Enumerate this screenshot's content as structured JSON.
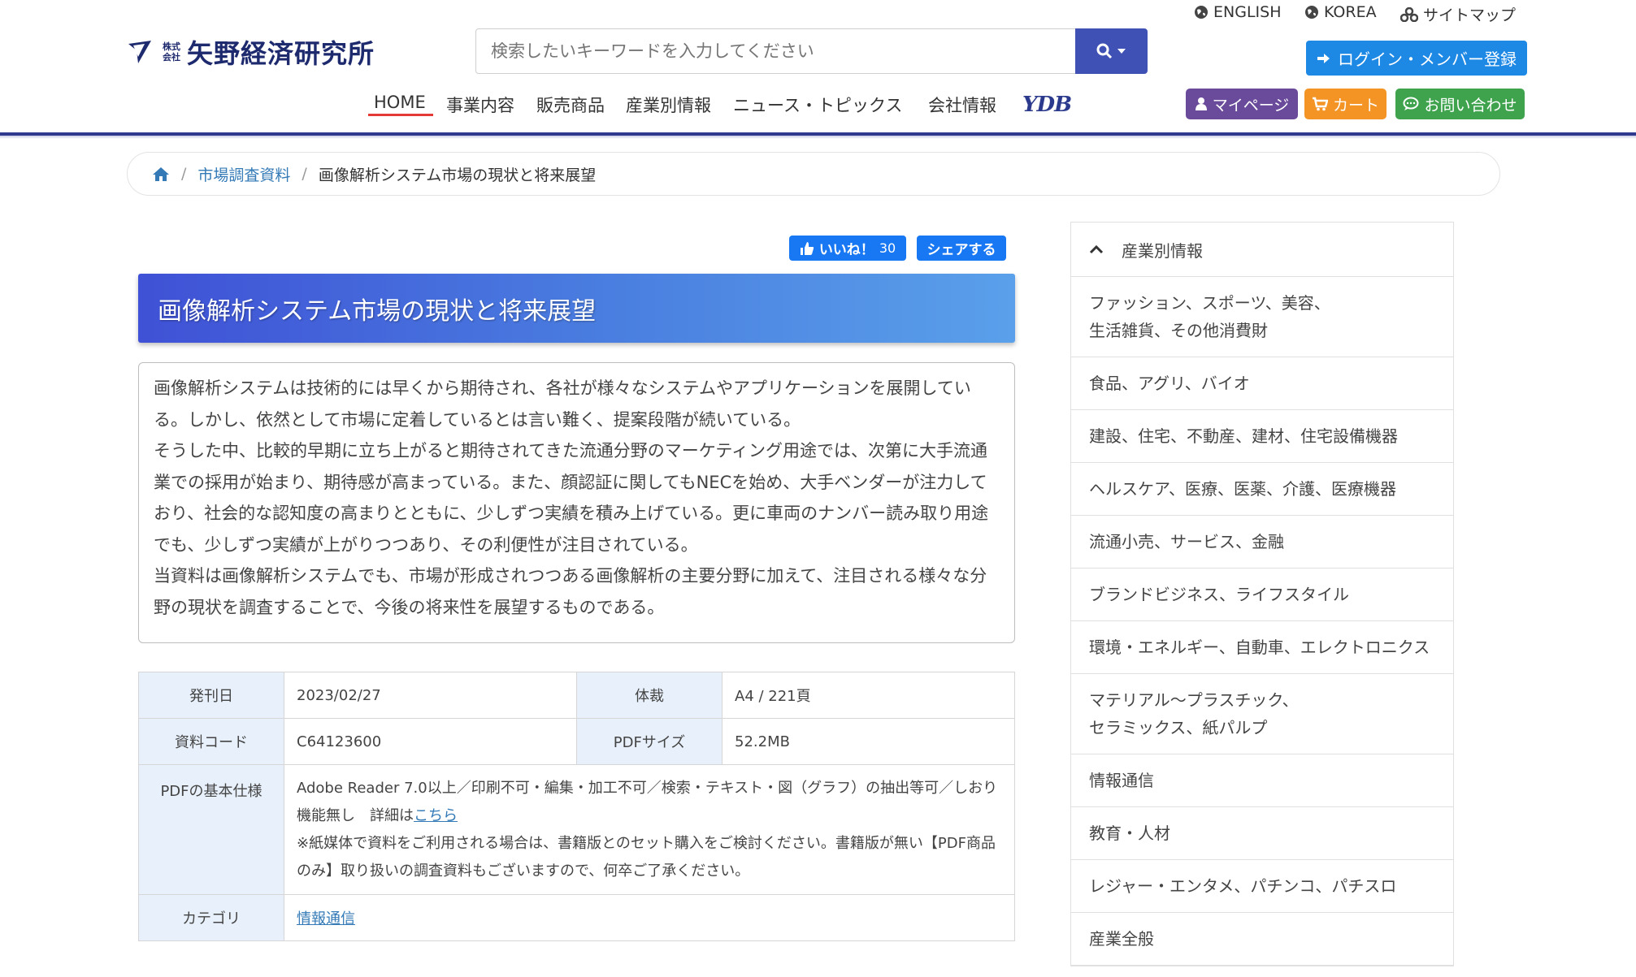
{
  "company": {
    "kabushiki": "株式",
    "kaisha": "会社",
    "name": "矢野経済研究所"
  },
  "search": {
    "placeholder": "検索したいキーワードを入力してください"
  },
  "top_links": {
    "english": "ENGLISH",
    "korea": "KOREA",
    "sitemap": "サイトマップ"
  },
  "login_label": "ログイン・メンバー登録",
  "nav": {
    "items": [
      "HOME",
      "事業内容",
      "販売商品",
      "産業別情報",
      "ニュース・トピックス",
      "会社情報"
    ],
    "ydb": "YDB"
  },
  "pills": {
    "mypage": "マイページ",
    "cart": "カート",
    "contact": "お問い合わせ"
  },
  "colors": {
    "accent": "#3f51b5",
    "mypage": "#6a4a9a",
    "cart": "#f39425",
    "contact": "#3fa34d",
    "login": "#1e88e5",
    "facebook": "#1877f2"
  },
  "breadcrumb": {
    "icon": "home-icon",
    "level1": "市場調査資料",
    "current": "画像解析システム市場の現状と将来展望"
  },
  "social": {
    "like_label": "いいね！",
    "like_count": "30",
    "share_label": "シェアする"
  },
  "title": "画像解析システム市場の現状と将来展望",
  "description": {
    "p1": "画像解析システムは技術的には早くから期待され、各社が様々なシステムやアプリケーションを展開している。しかし、依然として市場に定着しているとは言い難く、提案段階が続いている。",
    "p2": "そうした中、比較的早期に立ち上がると期待されてきた流通分野のマーケティング用途では、次第に大手流通業での採用が始まり、期待感が高まっている。また、顔認証に関してもNECを始め、大手ベンダーが注力しており、社会的な認知度の高まりとともに、少しずつ実績を積み上げている。更に車両のナンバー読み取り用途でも、少しずつ実績が上がりつつあり、その利便性が注目されている。",
    "p3": "当資料は画像解析システムでも、市場が形成されつつある画像解析の主要分野に加えて、注目される様々な分野の現状を調査することで、今後の将来性を展望するものである。"
  },
  "spec": {
    "issue_label": "発刊日",
    "issue_value": "2023/02/27",
    "format_label": "体裁",
    "format_value": "A4 / 221頁",
    "code_label": "資料コード",
    "code_value": "C64123600",
    "pdfsize_label": "PDFサイズ",
    "pdfsize_value": "52.2MB",
    "pdfspec_label": "PDFの基本仕様",
    "pdfspec_value": "Adobe Reader 7.0以上／印刷不可・編集・加工不可／検索・テキスト・図（グラフ）の抽出等可／しおり機能無し　詳細は",
    "pdfspec_link": "こちら",
    "pdfspec_note": "※紙媒体で資料をご利用される場合は、書籍版とのセット購入をご検討ください。書籍版が無い【PDF商品のみ】取り扱いの調査資料もございますので、何卒ご了承ください。",
    "category_label": "カテゴリ",
    "category_value": "情報通信"
  },
  "sidebar": {
    "heading": "産業別情報",
    "items": [
      "ファッション、スポーツ、美容、",
      "生活雑貨、その他消費財",
      "食品、アグリ、バイオ",
      "建設、住宅、不動産、建材、住宅設備機器",
      "ヘルスケア、医療、医薬、介護、医療機器",
      "流通小売、サービス、金融",
      "ブランドビジネス、ライフスタイル",
      "環境・エネルギー、自動車、エレクトロニクス",
      "マテリアル～プラスチック、",
      "セラミックス、紙パルプ",
      "情報通信",
      "教育・人材",
      "レジャー・エンタメ、パチンコ、パチスロ",
      "産業全般"
    ]
  }
}
